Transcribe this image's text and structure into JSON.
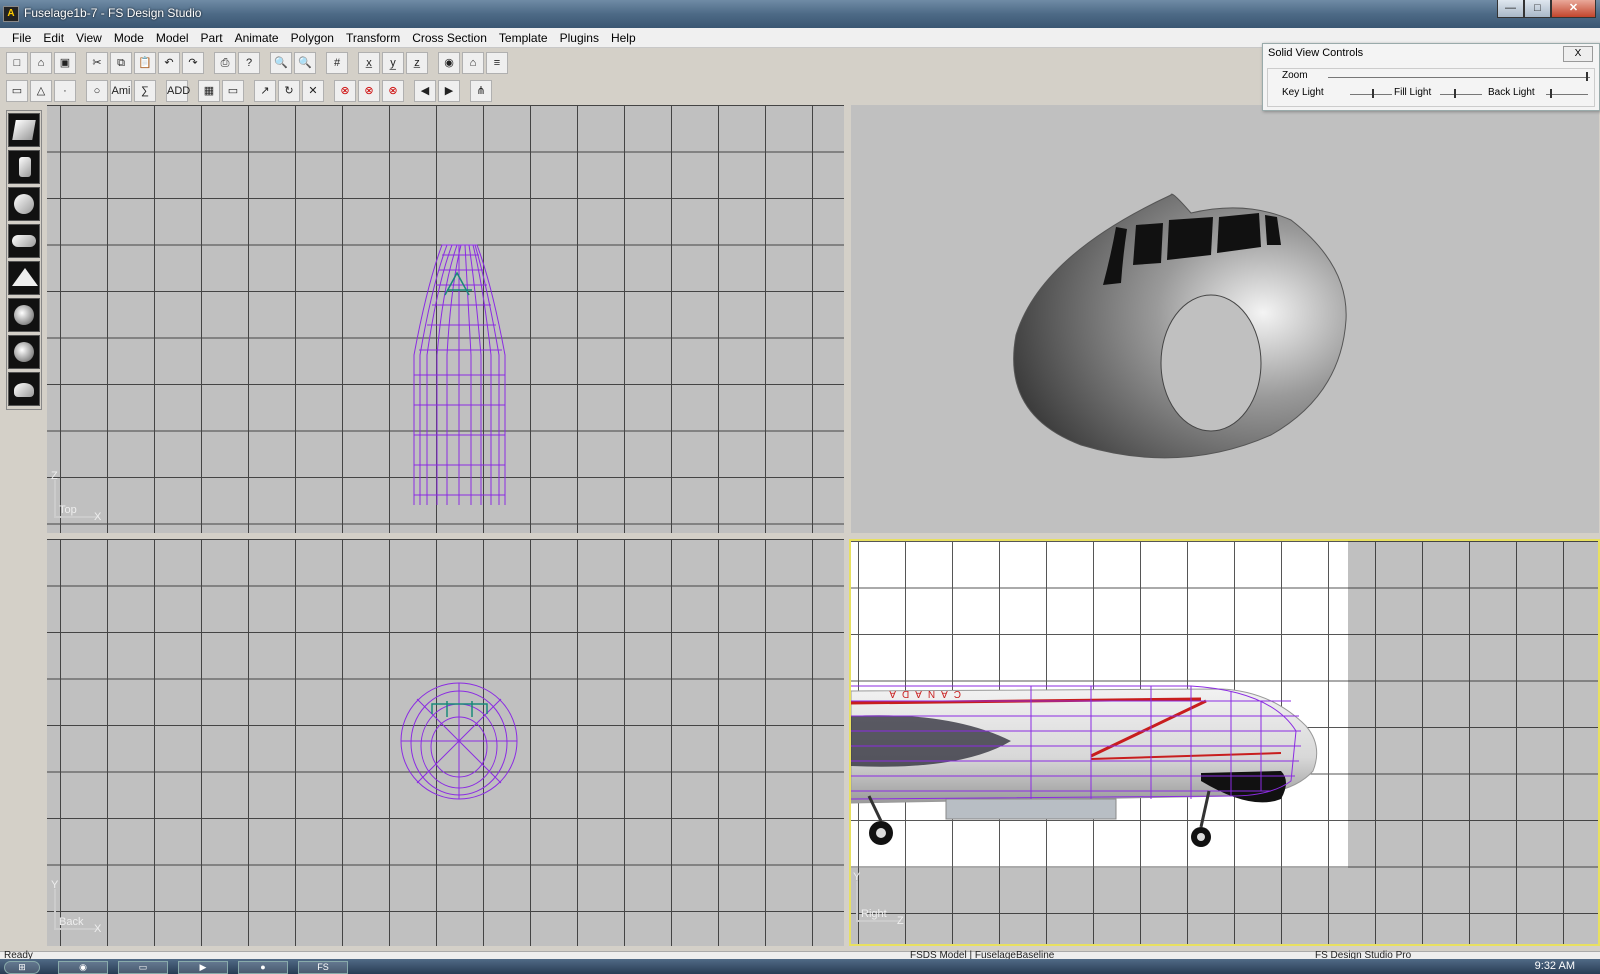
{
  "window": {
    "title": "Fuselage1b-7 - FS Design Studio",
    "icon": "app-logo-icon"
  },
  "menu": [
    "File",
    "Edit",
    "View",
    "Mode",
    "Model",
    "Part",
    "Animate",
    "Polygon",
    "Transform",
    "Cross Section",
    "Template",
    "Plugins",
    "Help"
  ],
  "toolbar1": [
    "□",
    "⌂",
    "▣",
    "✂",
    "⧉",
    "📋",
    "↶",
    "↷",
    "⎙",
    "?",
    "🔍",
    "🔍",
    "#",
    "x̲",
    "y̲",
    "z̲",
    "◉",
    "⌂",
    "≡"
  ],
  "toolbar2": [
    "▭",
    "△",
    "·",
    "Ami",
    "∑",
    "ADD",
    "▦",
    "▭",
    "↗",
    "↻",
    "✕",
    "⊗",
    "⊗",
    "⊗",
    "◀",
    "▶",
    "⋔"
  ],
  "left_tools": [
    "cube-shape",
    "cylinder-shape",
    "sphere-shape",
    "capsule-shape",
    "cone-shape",
    "textured-sphere-shape",
    "textured-sphere2-shape",
    "half-sphere-shape"
  ],
  "viewports": {
    "top": {
      "label": "Top",
      "axis_v": "Z",
      "axis_h": "X"
    },
    "back": {
      "label": "Back",
      "axis_v": "Y",
      "axis_h": "X"
    },
    "right": {
      "label": "Right",
      "axis_v": "Y",
      "axis_h": "Z"
    }
  },
  "solid_view_controls": {
    "title": "Solid View Controls",
    "close_label": "X",
    "zoom_label": "Zoom",
    "key_light_label": "Key Light",
    "fill_light_label": "Fill Light",
    "back_light_label": "Back Light"
  },
  "right_view": {
    "livery_text": "CANADA"
  },
  "status": {
    "left": "Ready",
    "model": "FSDS Model | FuselageBaseline",
    "app": "FS Design Studio Pro"
  },
  "clock": "9:32 AM",
  "colors": {
    "wireframe": "#8b2be2",
    "selection": "#e8e060",
    "grid": "#444444"
  }
}
